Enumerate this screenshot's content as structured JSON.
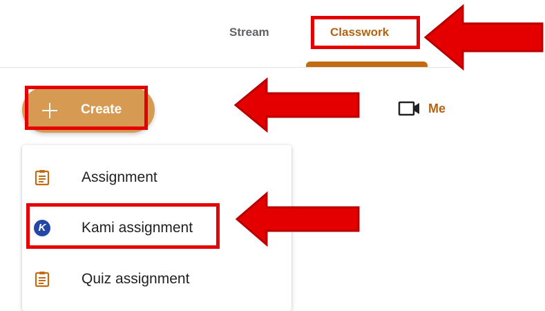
{
  "tabs": {
    "stream_label": "Stream",
    "classwork_label": "Classwork",
    "active_color": "#b56210",
    "inactive_color": "#5f6368"
  },
  "create": {
    "label": "Create",
    "icon": "plus-icon",
    "color": "#d79a52"
  },
  "meet": {
    "label": "Me",
    "icon": "video-icon"
  },
  "menu": {
    "items": [
      {
        "label": "Assignment",
        "icon": "assignment-icon"
      },
      {
        "label": "Kami assignment",
        "icon": "kami-logo-icon",
        "icon_text": "K"
      },
      {
        "label": "Quiz assignment",
        "icon": "assignment-icon"
      }
    ]
  },
  "annotations": {
    "highlight_color": "#e40000",
    "arrow_color": "#e40000"
  }
}
